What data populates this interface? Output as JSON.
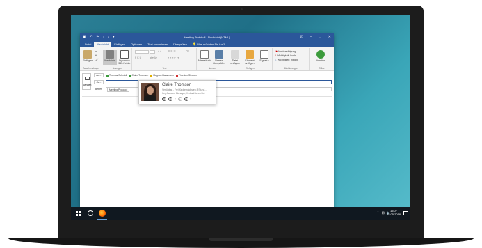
{
  "window": {
    "title": "Meeting Protokoll - Nachricht (HTML)",
    "controls": [
      "⊡",
      "−",
      "□",
      "✕"
    ]
  },
  "tabs": [
    {
      "label": "Datei"
    },
    {
      "label": "Nachricht"
    },
    {
      "label": "Einfügen"
    },
    {
      "label": "Optionen"
    },
    {
      "label": "Text formatieren"
    },
    {
      "label": "Überprüfen"
    },
    {
      "label": "Was möchten Sie tun?"
    }
  ],
  "ribbon": {
    "clipboard": {
      "paste": "Einfügen",
      "group": "Zwischenablage"
    },
    "dynamics": {
      "nachricht": "Nachricht",
      "fields": "Dynamics 365-Felder",
      "group": "Anzeigen"
    },
    "basic_text": {
      "group": "Text"
    },
    "names": {
      "addressbook": "Adressbuch",
      "check": "Namen überprüfen",
      "group": "Namen"
    },
    "include": {
      "file": "Datei anfügen",
      "item": "Element anfügen",
      "signature": "Signatur",
      "group": "Einfügen"
    },
    "tags": {
      "followup": "Nachverfolgung",
      "high": "Wichtigkeit: hoch",
      "low": "Wichtigkeit: niedrig",
      "group": "Markierungen"
    },
    "voice": {
      "label": "Anrufen",
      "group": "Office"
    }
  },
  "form": {
    "send": "Senden",
    "to_button": "An...",
    "cc_button": "Cc...",
    "subject_label": "Betreff",
    "subject_value": "Meeting Protokoll",
    "recipients": [
      {
        "name": "Thomas Schmidt",
        "color": "#3c9b3c"
      },
      {
        "name": "Claire Thomson",
        "color": "#3c9b3c"
      },
      {
        "name": "Magnus Hansmann",
        "color": "#e0b000"
      },
      {
        "name": "Thorsten Stroben",
        "color": "#d03030"
      }
    ]
  },
  "contact_card": {
    "name": "Claire Thomson",
    "status": "Verfügbar - Frei für die nächsten 8 Stund...",
    "role": "Key Account Manager, Verkaufsteam Ltd."
  },
  "taskbar": {
    "time": "15:07",
    "date": "15.05.2018"
  }
}
